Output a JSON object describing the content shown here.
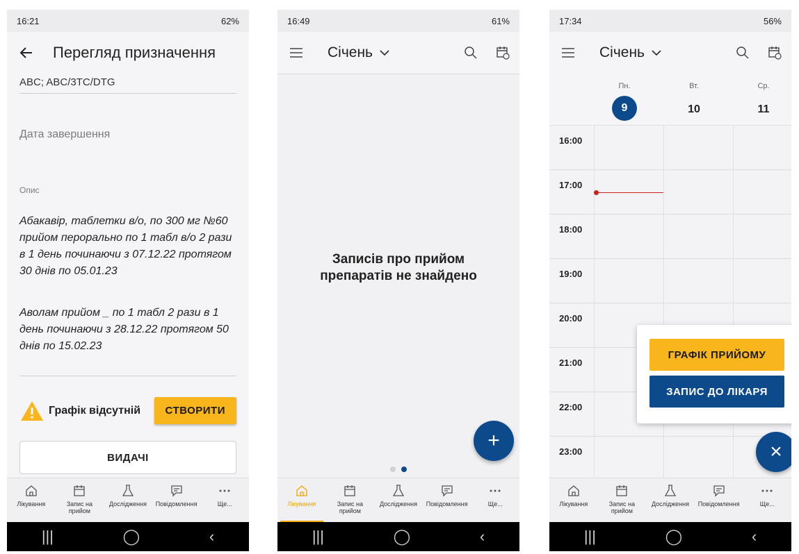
{
  "phone1": {
    "status": {
      "time": "16:21",
      "battery": "62%"
    },
    "title": "Перегляд призначення",
    "cut_text": "ABC; ABC/3TC/DTG",
    "end_date_label": "Дата завершення",
    "description_label": "Опис",
    "description_1": "Абакавір, таблетки в/о, по 300 мг №60 прийом перорально по 1 табл в/о 2 рази в 1 день починаючи з 07.12.22 протягом 30 днів по 05.01.23",
    "description_2": "Аволам прийом _ по 1 табл 2 рази в 1 день починаючи з 28.12.22 протягом 50 днів по 15.02.23",
    "schedule_missing": "Графік відсутній",
    "create_button": "СТВОРИТИ",
    "issues_button": "ВИДАЧІ"
  },
  "phone2": {
    "status": {
      "time": "16:49",
      "battery": "61%"
    },
    "month": "Січень",
    "empty_message": "Записів про прийом препаратів не знайдено",
    "fab": "+"
  },
  "phone3": {
    "status": {
      "time": "17:34",
      "battery": "56%"
    },
    "month": "Січень",
    "days": [
      {
        "dow": "Пн.",
        "num": "9"
      },
      {
        "dow": "Вт.",
        "num": "10"
      },
      {
        "dow": "Ср.",
        "num": "11"
      }
    ],
    "hours": [
      "16:00",
      "17:00",
      "18:00",
      "19:00",
      "20:00",
      "21:00",
      "22:00",
      "23:00"
    ],
    "popup": {
      "schedule_button": "ГРАФІК ПРИЙОМУ",
      "doctor_button": "ЗАПИС ДО ЛІКАРЯ"
    },
    "fab": "×"
  },
  "bottom_nav": [
    {
      "label": "Лікування",
      "icon": "home-icon"
    },
    {
      "label": "Запис на прийом",
      "icon": "calendar-icon"
    },
    {
      "label": "Дослідження",
      "icon": "flask-icon"
    },
    {
      "label": "Повідомлення",
      "icon": "message-icon"
    },
    {
      "label": "Ще...",
      "icon": "more-icon"
    }
  ],
  "colors": {
    "accent": "#f9b51c",
    "primary": "#0d4a8c",
    "now_line": "#cc2222"
  }
}
